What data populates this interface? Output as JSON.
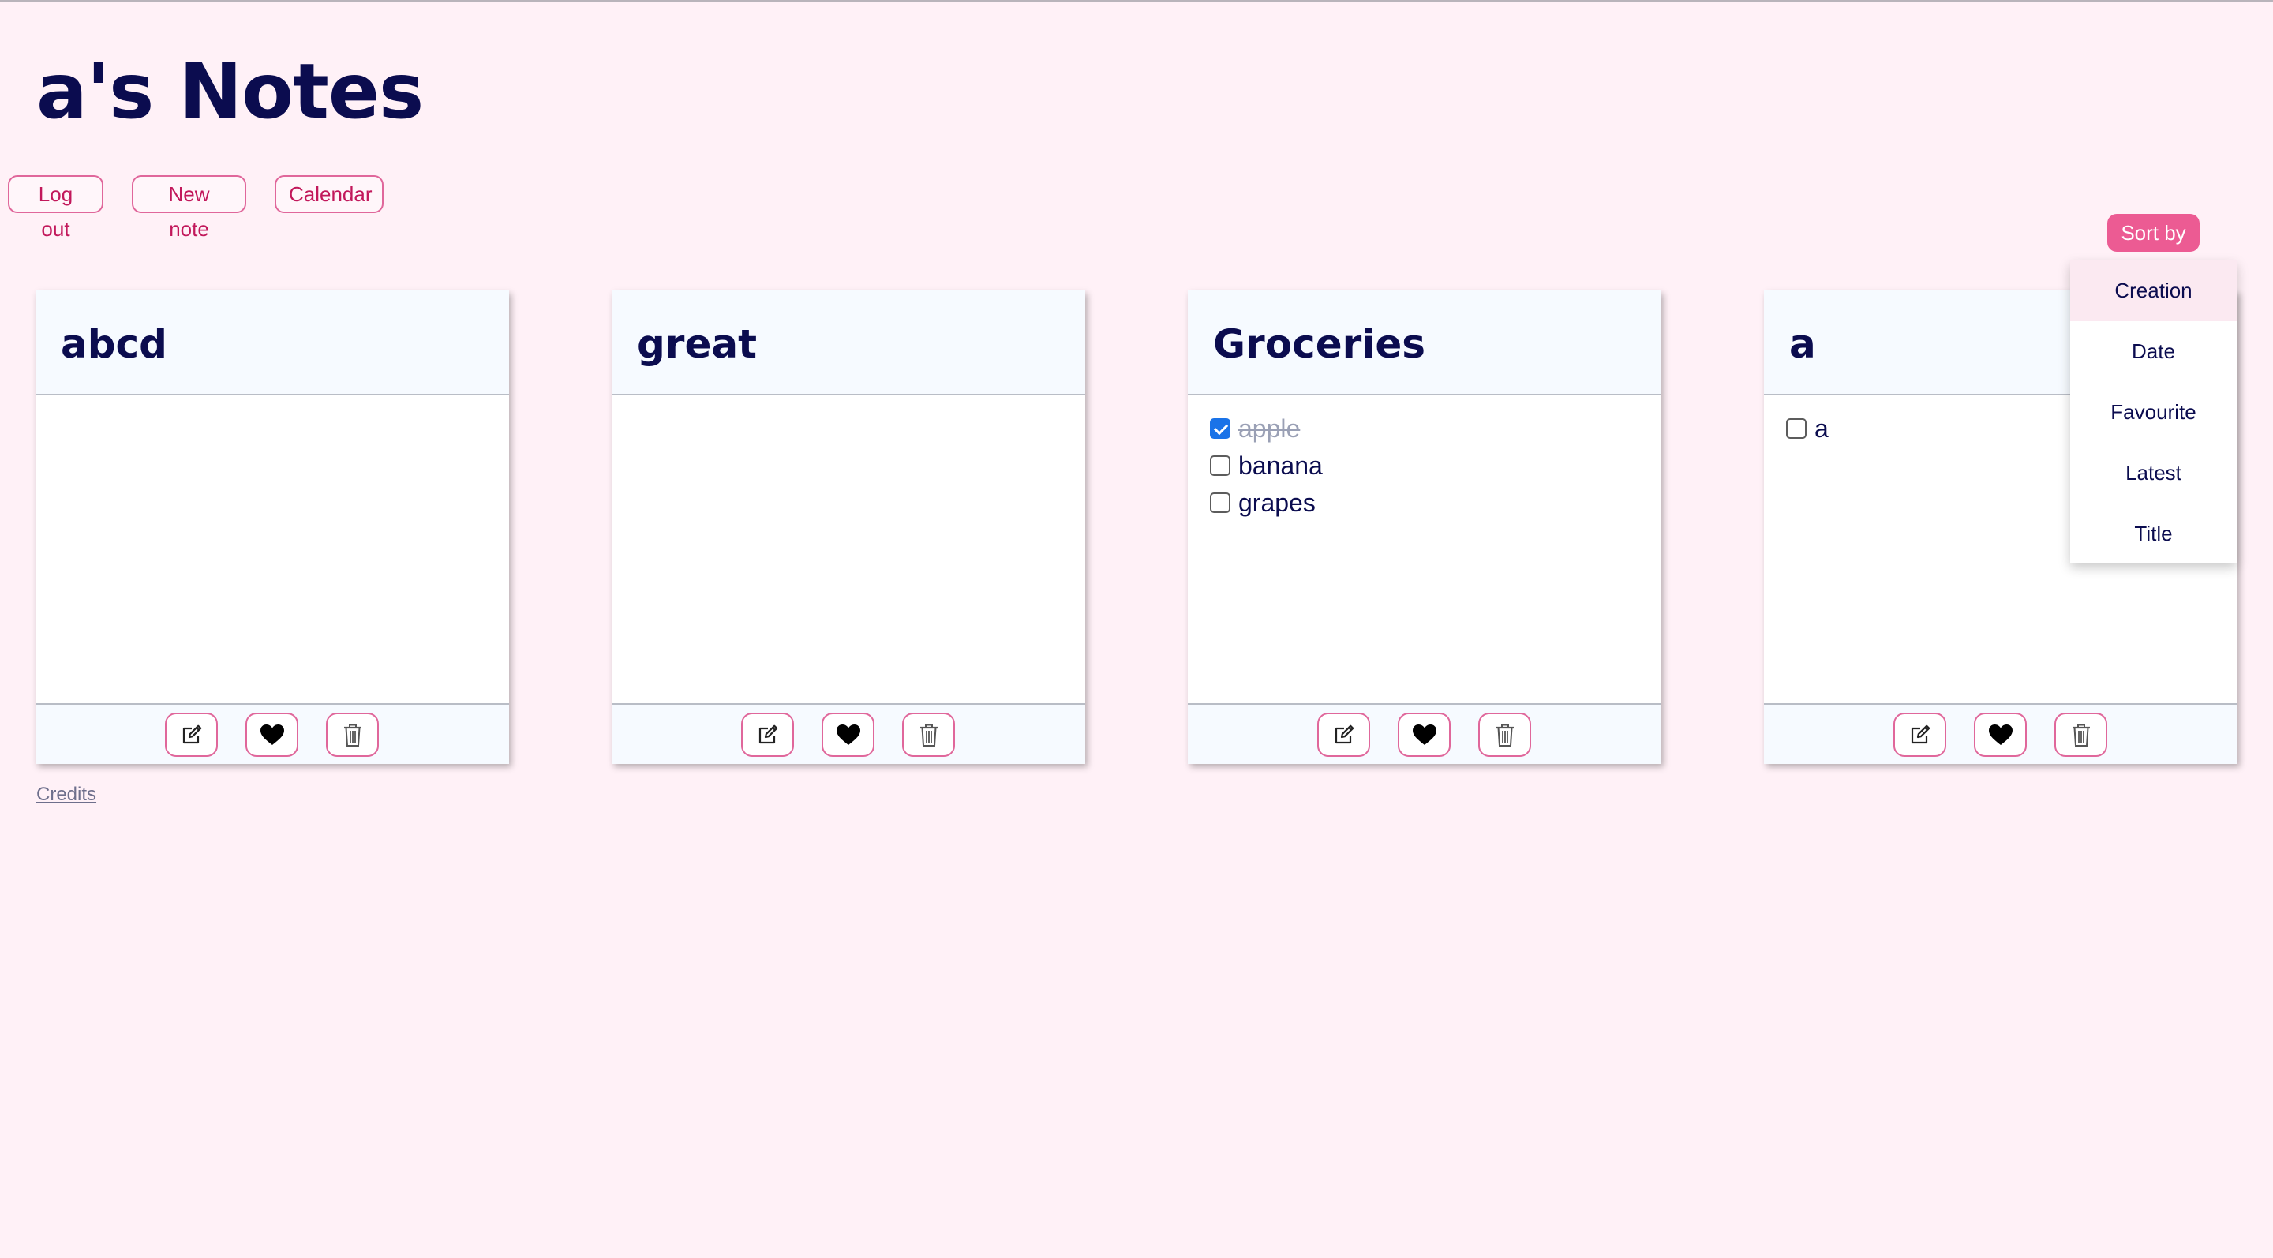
{
  "header": {
    "title": "a's Notes"
  },
  "nav": {
    "logout_label": "Log out",
    "new_note_label": "New note",
    "calendar_label": "Calendar"
  },
  "sort": {
    "button_label": "Sort by",
    "options": [
      "Creation",
      "Date",
      "Favourite",
      "Latest",
      "Title"
    ],
    "highlighted_option": "Creation"
  },
  "notes": [
    {
      "title": "abcd",
      "items": []
    },
    {
      "title": "great",
      "items": []
    },
    {
      "title": "Groceries",
      "items": [
        {
          "label": "apple",
          "checked": true
        },
        {
          "label": "banana",
          "checked": false
        },
        {
          "label": "grapes",
          "checked": false
        }
      ]
    },
    {
      "title": "a",
      "items": [
        {
          "label": "a",
          "checked": false
        }
      ]
    }
  ],
  "footer": {
    "credits_label": "Credits"
  },
  "icons": {
    "edit": "edit-icon",
    "favourite": "heart-icon",
    "delete": "trash-icon"
  },
  "colors": {
    "background": "#fff1f7",
    "accent": "#ec5b93",
    "button_border": "#e0679b",
    "button_text": "#c2185b",
    "title_text": "#0b0c4f",
    "card_header": "#f6faff",
    "checkbox_checked": "#1a73e8"
  }
}
